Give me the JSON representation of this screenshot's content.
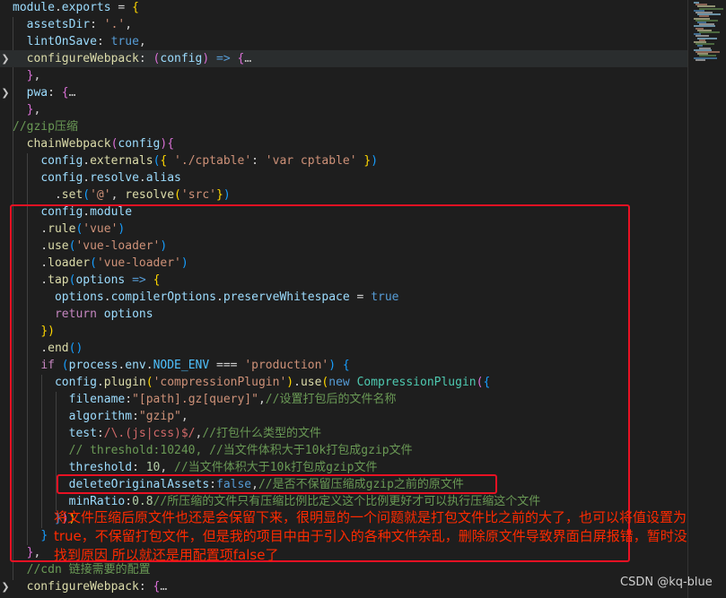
{
  "code_lines": [
    [
      [
        "t-v",
        "module"
      ],
      [
        "t-p",
        "."
      ],
      [
        "t-v",
        "exports"
      ],
      [
        "t-p",
        " = "
      ],
      [
        "t-b1",
        "{"
      ]
    ],
    [
      [
        "t-p",
        "  "
      ],
      [
        "t-v",
        "assetsDir"
      ],
      [
        "t-p",
        ": "
      ],
      [
        "t-s",
        "'.'"
      ],
      [
        "t-p",
        ","
      ]
    ],
    [
      [
        "t-p",
        "  "
      ],
      [
        "t-v",
        "lintOnSave"
      ],
      [
        "t-p",
        ": "
      ],
      [
        "t-kb",
        "true"
      ],
      [
        "t-p",
        ","
      ]
    ],
    [
      [
        "t-p",
        "  "
      ],
      [
        "t-f",
        "configureWebpack"
      ],
      [
        "t-p",
        ": "
      ],
      [
        "t-b2",
        "("
      ],
      [
        "t-v",
        "config"
      ],
      [
        "t-b2",
        ")"
      ],
      [
        "t-p",
        " "
      ],
      [
        "t-kb",
        "=>"
      ],
      [
        "t-p",
        " "
      ],
      [
        "t-b2",
        "{"
      ],
      [
        "t-ell",
        "…"
      ]
    ],
    [
      [
        "t-p",
        "  "
      ],
      [
        "t-b2",
        "}"
      ],
      [
        "t-p",
        ","
      ]
    ],
    [
      [
        "t-p",
        "  "
      ],
      [
        "t-v",
        "pwa"
      ],
      [
        "t-p",
        ": "
      ],
      [
        "t-b2",
        "{"
      ],
      [
        "t-ell",
        "…"
      ]
    ],
    [
      [
        "t-p",
        "  "
      ],
      [
        "t-b2",
        "}"
      ],
      [
        "t-p",
        ","
      ]
    ],
    [
      [
        "t-c",
        "//gzip压缩"
      ]
    ],
    [
      [
        "t-p",
        "  "
      ],
      [
        "t-f",
        "chainWebpack"
      ],
      [
        "t-b2",
        "("
      ],
      [
        "t-v",
        "config"
      ],
      [
        "t-b2",
        ")"
      ],
      [
        "t-b2",
        "{"
      ]
    ],
    [
      [
        "t-p",
        "    "
      ],
      [
        "t-v",
        "config"
      ],
      [
        "t-p",
        "."
      ],
      [
        "t-f",
        "externals"
      ],
      [
        "t-b3",
        "("
      ],
      [
        "t-b1",
        "{"
      ],
      [
        "t-p",
        " "
      ],
      [
        "t-s",
        "'./cptable'"
      ],
      [
        "t-p",
        ": "
      ],
      [
        "t-s",
        "'var cptable'"
      ],
      [
        "t-p",
        " "
      ],
      [
        "t-b1",
        "}"
      ],
      [
        "t-b3",
        ")"
      ]
    ],
    [
      [
        "t-p",
        "    "
      ],
      [
        "t-v",
        "config"
      ],
      [
        "t-p",
        "."
      ],
      [
        "t-v",
        "resolve"
      ],
      [
        "t-p",
        "."
      ],
      [
        "t-v",
        "alias"
      ]
    ],
    [
      [
        "t-p",
        "      ."
      ],
      [
        "t-f",
        "set"
      ],
      [
        "t-b3",
        "("
      ],
      [
        "t-s",
        "'@'"
      ],
      [
        "t-p",
        ", "
      ],
      [
        "t-f",
        "resolve"
      ],
      [
        "t-b1",
        "("
      ],
      [
        "t-s",
        "'src'"
      ],
      [
        "t-b1",
        "}"
      ],
      [
        "t-b3",
        ")"
      ]
    ],
    [
      [
        "t-p",
        "    "
      ],
      [
        "t-v",
        "config"
      ],
      [
        "t-p",
        "."
      ],
      [
        "t-v",
        "module"
      ]
    ],
    [
      [
        "t-p",
        "    ."
      ],
      [
        "t-f",
        "rule"
      ],
      [
        "t-b3",
        "("
      ],
      [
        "t-s",
        "'vue'"
      ],
      [
        "t-b3",
        ")"
      ]
    ],
    [
      [
        "t-p",
        "    ."
      ],
      [
        "t-f",
        "use"
      ],
      [
        "t-b3",
        "("
      ],
      [
        "t-s",
        "'vue-loader'"
      ],
      [
        "t-b3",
        ")"
      ]
    ],
    [
      [
        "t-p",
        "    ."
      ],
      [
        "t-f",
        "loader"
      ],
      [
        "t-b3",
        "("
      ],
      [
        "t-s",
        "'vue-loader'"
      ],
      [
        "t-b3",
        ")"
      ]
    ],
    [
      [
        "t-p",
        "    ."
      ],
      [
        "t-f",
        "tap"
      ],
      [
        "t-b3",
        "("
      ],
      [
        "t-v",
        "options"
      ],
      [
        "t-p",
        " "
      ],
      [
        "t-kb",
        "=>"
      ],
      [
        "t-p",
        " "
      ],
      [
        "t-b1",
        "{"
      ]
    ],
    [
      [
        "t-p",
        "      "
      ],
      [
        "t-v",
        "options"
      ],
      [
        "t-p",
        "."
      ],
      [
        "t-v",
        "compilerOptions"
      ],
      [
        "t-p",
        "."
      ],
      [
        "t-v",
        "preserveWhitespace"
      ],
      [
        "t-p",
        " = "
      ],
      [
        "t-kb",
        "true"
      ]
    ],
    [
      [
        "t-p",
        "      "
      ],
      [
        "t-k",
        "return"
      ],
      [
        "t-p",
        " "
      ],
      [
        "t-v",
        "options"
      ]
    ],
    [
      [
        "t-p",
        "    "
      ],
      [
        "t-b1",
        "})"
      ]
    ],
    [
      [
        "t-p",
        "    ."
      ],
      [
        "t-f",
        "end"
      ],
      [
        "t-b3",
        "()"
      ]
    ],
    [
      [
        "t-p",
        "    "
      ],
      [
        "t-k",
        "if"
      ],
      [
        "t-p",
        " "
      ],
      [
        "t-b3",
        "("
      ],
      [
        "t-v",
        "process"
      ],
      [
        "t-p",
        "."
      ],
      [
        "t-v",
        "env"
      ],
      [
        "t-p",
        "."
      ],
      [
        "t-cn",
        "NODE_ENV"
      ],
      [
        "t-p",
        " === "
      ],
      [
        "t-s",
        "'production'"
      ],
      [
        "t-b3",
        ")"
      ],
      [
        "t-p",
        " "
      ],
      [
        "t-b3",
        "{"
      ]
    ],
    [
      [
        "t-p",
        "      "
      ],
      [
        "t-v",
        "config"
      ],
      [
        "t-p",
        "."
      ],
      [
        "t-f",
        "plugin"
      ],
      [
        "t-b1",
        "("
      ],
      [
        "t-s",
        "'compressionPlugin'"
      ],
      [
        "t-b1",
        ")"
      ],
      [
        "t-p",
        "."
      ],
      [
        "t-f",
        "use"
      ],
      [
        "t-b1",
        "("
      ],
      [
        "t-kb",
        "new"
      ],
      [
        "t-p",
        " "
      ],
      [
        "t-cls",
        "CompressionPlugin"
      ],
      [
        "t-b2",
        "("
      ],
      [
        "t-b3",
        "{"
      ]
    ],
    [
      [
        "t-p",
        "        "
      ],
      [
        "t-v",
        "filename"
      ],
      [
        "t-p",
        ":"
      ],
      [
        "t-s",
        "\"[path].gz[query]\""
      ],
      [
        "t-p",
        ","
      ],
      [
        "t-c",
        "//设置打包后的文件名称"
      ]
    ],
    [
      [
        "t-p",
        "        "
      ],
      [
        "t-v",
        "algorithm"
      ],
      [
        "t-p",
        ":"
      ],
      [
        "t-s",
        "\"gzip\""
      ],
      [
        "t-p",
        ","
      ]
    ],
    [
      [
        "t-p",
        "        "
      ],
      [
        "t-v",
        "test"
      ],
      [
        "t-p",
        ":"
      ],
      [
        "t-r",
        "/\\.(js|css)$/"
      ],
      [
        "t-p",
        ","
      ],
      [
        "t-c",
        "//打包什么类型的文件"
      ]
    ],
    [
      [
        "t-p",
        "        "
      ],
      [
        "t-c",
        "// threshold:10240, //当文件体积大于10k打包成gzip文件"
      ]
    ],
    [
      [
        "t-p",
        "        "
      ],
      [
        "t-v",
        "threshold"
      ],
      [
        "t-p",
        ": "
      ],
      [
        "t-n",
        "10"
      ],
      [
        "t-p",
        ", "
      ],
      [
        "t-c",
        "//当文件体积大于10k打包成gzip文件"
      ]
    ],
    [
      [
        "t-p",
        "        "
      ],
      [
        "t-v",
        "deleteOriginalAssets"
      ],
      [
        "t-p",
        ":"
      ],
      [
        "t-kb",
        "false"
      ],
      [
        "t-p",
        ","
      ],
      [
        "t-c",
        "//是否不保留压缩成gzip之前的原文件"
      ]
    ],
    [
      [
        "t-p",
        "        "
      ],
      [
        "t-v",
        "minRatio"
      ],
      [
        "t-p",
        ":"
      ],
      [
        "t-n",
        "0.8"
      ],
      [
        "t-c",
        "//所压缩的文件只有压缩比例比定义这个比例更好才可以执行压缩这个文件"
      ]
    ],
    [
      [
        "t-p",
        "      "
      ],
      [
        "t-b3",
        "}"
      ],
      [
        "t-b2",
        ")"
      ],
      [
        "t-b1",
        ")"
      ]
    ],
    [
      [
        "t-p",
        "    "
      ],
      [
        "t-b3",
        "}"
      ]
    ],
    [
      [
        "t-p",
        "  "
      ],
      [
        "t-b2",
        "}"
      ],
      [
        "t-p",
        ","
      ]
    ],
    [
      [
        "t-c",
        "  //cdn 链接需要的配置"
      ]
    ],
    [
      [
        "t-p",
        "  "
      ],
      [
        "t-f",
        "configureWebpack"
      ],
      [
        "t-p",
        ": "
      ],
      [
        "t-b2",
        "{"
      ],
      [
        "t-ell",
        "…"
      ]
    ]
  ],
  "folded_lines": [
    3,
    5,
    34
  ],
  "highlight_lines": [
    3
  ],
  "annotation": "将文件压缩后原文件也还是会保留下来，很明显的一个问题就是打包文件比之前的大了，也可以将值设置为true，不保留打包文件，但是我的项目中由于引入的各种文件杂乱，删除原文件导致界面白屏报错，暂时没找到原因 所以就还是用配置项false了",
  "watermark": "CSDN @kq-blue",
  "colors": {
    "background": "#1e1e1e",
    "annotation_box": "#e81123",
    "annotation_text": "#ff2a00"
  },
  "icons": {
    "fold": "chevron-right-icon"
  }
}
